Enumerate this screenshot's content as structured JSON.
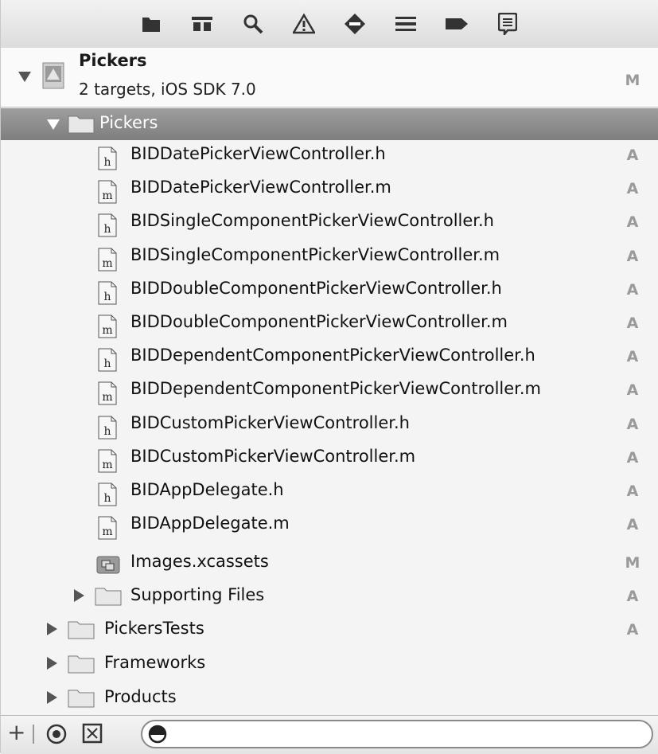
{
  "toolbar": {
    "icons": [
      "folder-icon",
      "hierarchy-icon",
      "search-icon",
      "warning-icon",
      "test-diamond-icon",
      "debug-list-icon",
      "breakpoint-icon",
      "log-bubble-icon"
    ]
  },
  "project": {
    "name": "Pickers",
    "subtitle": "2 targets, iOS SDK 7.0",
    "status": "M"
  },
  "group": {
    "name": "Pickers"
  },
  "files": [
    {
      "name": "BIDDatePickerViewController.h",
      "type": "h",
      "status": "A"
    },
    {
      "name": "BIDDatePickerViewController.m",
      "type": "m",
      "status": "A"
    },
    {
      "name": "BIDSingleComponentPickerViewController.h",
      "type": "h",
      "status": "A"
    },
    {
      "name": "BIDSingleComponentPickerViewController.m",
      "type": "m",
      "status": "A"
    },
    {
      "name": "BIDDoubleComponentPickerViewController.h",
      "type": "h",
      "status": "A"
    },
    {
      "name": "BIDDoubleComponentPickerViewController.m",
      "type": "m",
      "status": "A"
    },
    {
      "name": "BIDDependentComponentPickerViewController.h",
      "type": "h",
      "status": "A"
    },
    {
      "name": "BIDDependentComponentPickerViewController.m",
      "type": "m",
      "status": "A"
    },
    {
      "name": "BIDCustomPickerViewController.h",
      "type": "h",
      "status": "A"
    },
    {
      "name": "BIDCustomPickerViewController.m",
      "type": "m",
      "status": "A"
    },
    {
      "name": "BIDAppDelegate.h",
      "type": "h",
      "status": "A"
    },
    {
      "name": "BIDAppDelegate.m",
      "type": "m",
      "status": "A"
    }
  ],
  "assets": {
    "name": "Images.xcassets",
    "status": "M"
  },
  "supporting": {
    "name": "Supporting Files",
    "status": "A"
  },
  "top_groups": [
    {
      "name": "PickersTests",
      "status": "A"
    },
    {
      "name": "Frameworks",
      "status": ""
    },
    {
      "name": "Products",
      "status": ""
    }
  ],
  "footer": {
    "add": "+"
  }
}
